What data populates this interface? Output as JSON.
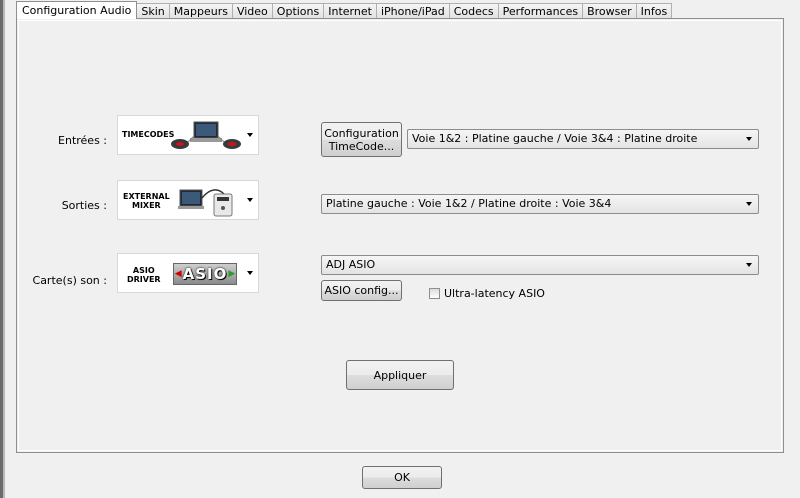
{
  "tabs": [
    {
      "label": "Configuration Audio",
      "active": true
    },
    {
      "label": "Skin"
    },
    {
      "label": "Mappeurs"
    },
    {
      "label": "Video"
    },
    {
      "label": "Options"
    },
    {
      "label": "Internet"
    },
    {
      "label": "iPhone/iPad"
    },
    {
      "label": "Codecs"
    },
    {
      "label": "Performances"
    },
    {
      "label": "Browser"
    },
    {
      "label": "Infos"
    }
  ],
  "inputs": {
    "label": "Entrées :",
    "image_text": "TIMECODES",
    "config_button": "Configuration TimeCode...",
    "config_line1": "Configuration",
    "config_line2": "TimeCode...",
    "routing": "Voie 1&2 : Platine gauche / Voie 3&4 : Platine droite"
  },
  "outputs": {
    "label": "Sorties :",
    "image_text": "EXTERNAL MIXER",
    "image_line1": "EXTERNAL",
    "image_line2": "MIXER",
    "routing": "Platine gauche : Voie 1&2 / Platine droite : Voie 3&4"
  },
  "soundcard": {
    "label": "Carte(s) son :",
    "image_text": "ASIO DRIVER",
    "image_line1": "ASIO",
    "image_line2": "DRIVER",
    "logo_text": "ASIO",
    "device": "ADJ ASIO",
    "asio_config_button": "ASIO config...",
    "ultra_latency_label": "Ultra-latency ASIO",
    "ultra_latency_checked": false
  },
  "apply_button": "Appliquer",
  "ok_button": "OK",
  "colors": {
    "dialog_bg": "#f0f0f0",
    "asio_logo_red": "#d40000",
    "asio_logo_green": "#2f9a2f"
  }
}
